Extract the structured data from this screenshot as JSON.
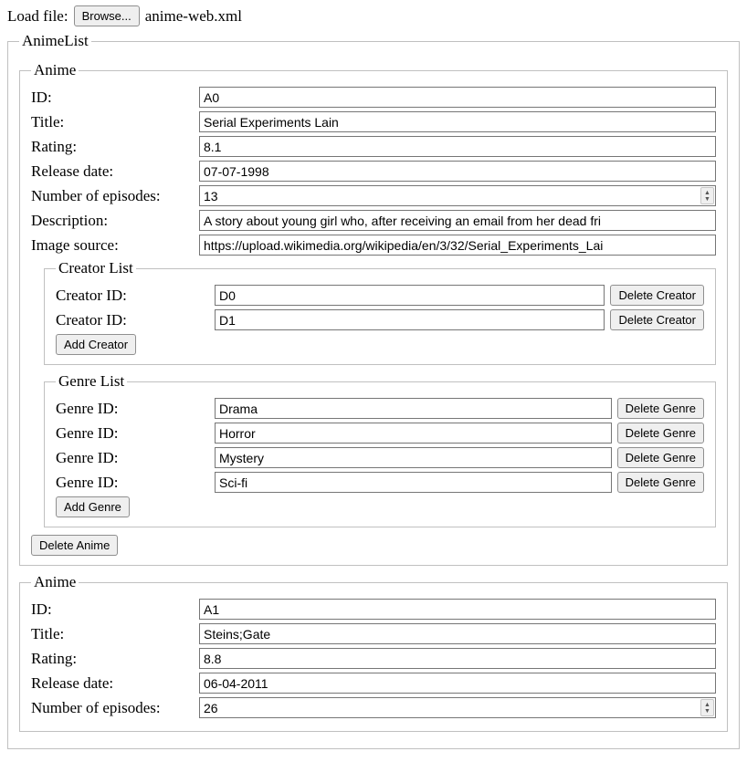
{
  "fileLoader": {
    "label": "Load file:",
    "browseButton": "Browse...",
    "fileName": "anime-web.xml"
  },
  "animeList": {
    "legend": "AnimeList",
    "animeLegend": "Anime",
    "labels": {
      "id": "ID:",
      "title": "Title:",
      "rating": "Rating:",
      "releaseDate": "Release date:",
      "episodes": "Number of episodes:",
      "description": "Description:",
      "imageSource": "Image source:",
      "creatorListLegend": "Creator List",
      "creatorId": "Creator ID:",
      "genreListLegend": "Genre List",
      "genreId": "Genre ID:",
      "deleteCreator": "Delete Creator",
      "addCreator": "Add Creator",
      "deleteGenre": "Delete Genre",
      "addGenre": "Add Genre",
      "deleteAnime": "Delete Anime"
    },
    "animes": [
      {
        "id": "A0",
        "title": "Serial Experiments Lain",
        "rating": "8.1",
        "releaseDate": "07-07-1998",
        "episodes": "13",
        "description": "A story about young girl who, after receiving an email from her dead fri",
        "imageSource": "https://upload.wikimedia.org/wikipedia/en/3/32/Serial_Experiments_Lai",
        "creators": [
          "D0",
          "D1"
        ],
        "genres": [
          "Drama",
          "Horror",
          "Mystery",
          "Sci-fi"
        ]
      },
      {
        "id": "A1",
        "title": "Steins;Gate",
        "rating": "8.8",
        "releaseDate": "06-04-2011",
        "episodes": "26"
      }
    ]
  }
}
